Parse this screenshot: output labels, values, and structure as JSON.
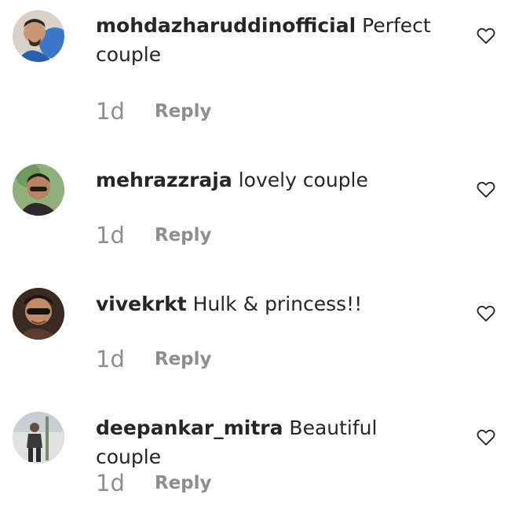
{
  "comments": [
    {
      "username": "mohdazharuddinofficial",
      "text": "Perfect couple",
      "time": "1d",
      "reply_label": "Reply"
    },
    {
      "username": "mehrazzraja",
      "text": "lovely couple",
      "time": "1d",
      "reply_label": "Reply"
    },
    {
      "username": "vivekrkt",
      "text": "Hulk & princess!!",
      "time": "1d",
      "reply_label": "Reply"
    },
    {
      "username": "deepankar_mitra",
      "text": "Beautiful couple",
      "time": "1d",
      "reply_label": "Reply"
    }
  ],
  "icons": {
    "like": "heart-outline-icon"
  },
  "colors": {
    "text": "#262626",
    "secondary": "#8e8e8e"
  }
}
